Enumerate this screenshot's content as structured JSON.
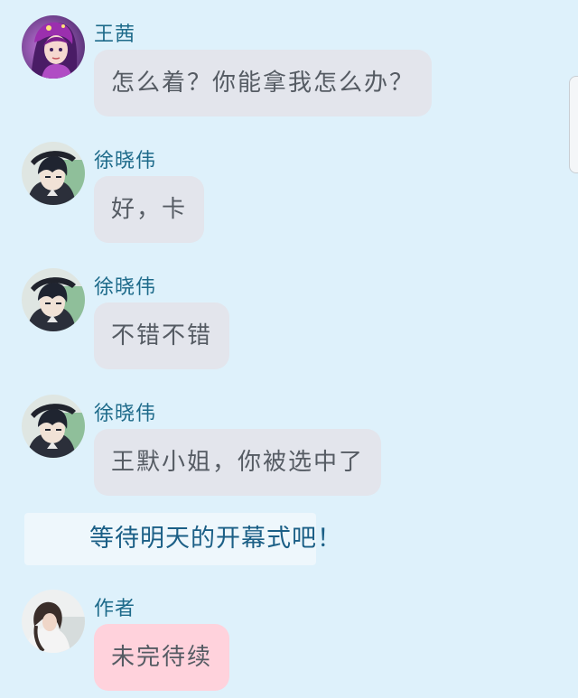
{
  "messages": [
    {
      "sender": "王茜",
      "text": "怎么着？你能拿我怎么办？",
      "avatar_icon": "purple-hair-girl-avatar",
      "bubble_color": "#e3e5ec"
    },
    {
      "sender": "徐晓伟",
      "text": "好，卡",
      "avatar_icon": "boy-with-cap-avatar",
      "bubble_color": "#e3e5ec"
    },
    {
      "sender": "徐晓伟",
      "text": "不错不错",
      "avatar_icon": "boy-with-cap-avatar",
      "bubble_color": "#e3e5ec"
    },
    {
      "sender": "徐晓伟",
      "text": "王默小姐，你被选中了",
      "avatar_icon": "boy-with-cap-avatar",
      "bubble_color": "#e3e5ec"
    }
  ],
  "narration": {
    "text": "等待明天的开幕式吧！"
  },
  "author_message": {
    "sender": "作者",
    "text": "未完待续",
    "avatar_icon": "girl-photo-avatar",
    "bubble_color": "#ffd2dc"
  },
  "colors": {
    "background": "#def1fb",
    "sender_name": "#1d6a8a",
    "narration_text": "#1b5f86"
  }
}
